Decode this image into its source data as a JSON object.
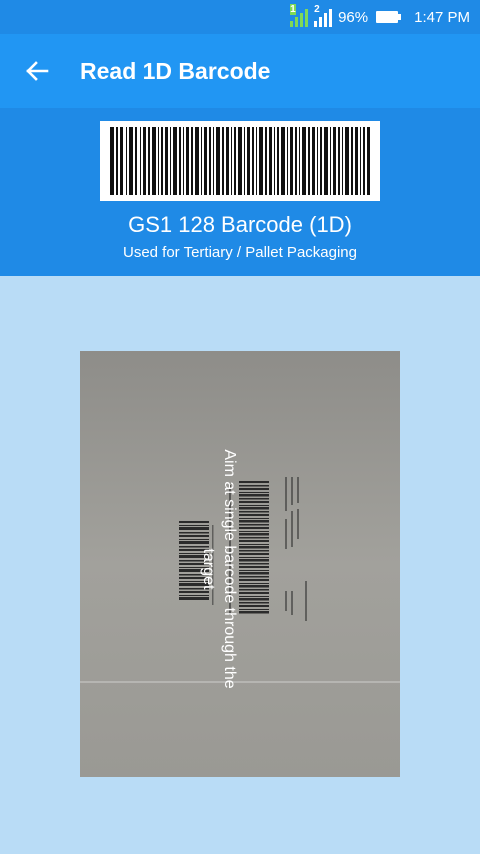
{
  "status_bar": {
    "sim1_label": "1",
    "sim2_label": "2",
    "battery_percent": "96%",
    "time": "1:47 PM"
  },
  "app_bar": {
    "title": "Read 1D Barcode",
    "back_icon": "arrow-left-icon"
  },
  "barcode_info": {
    "name": "GS1 128 Barcode (1D)",
    "usage": "Used for Tertiary / Pallet Packaging"
  },
  "scanner": {
    "instruction": "Aim at single barcode through the target"
  },
  "colors": {
    "status_bar": "#1f8ae6",
    "app_bar": "#2196f3",
    "background": "#b9dcf6"
  }
}
